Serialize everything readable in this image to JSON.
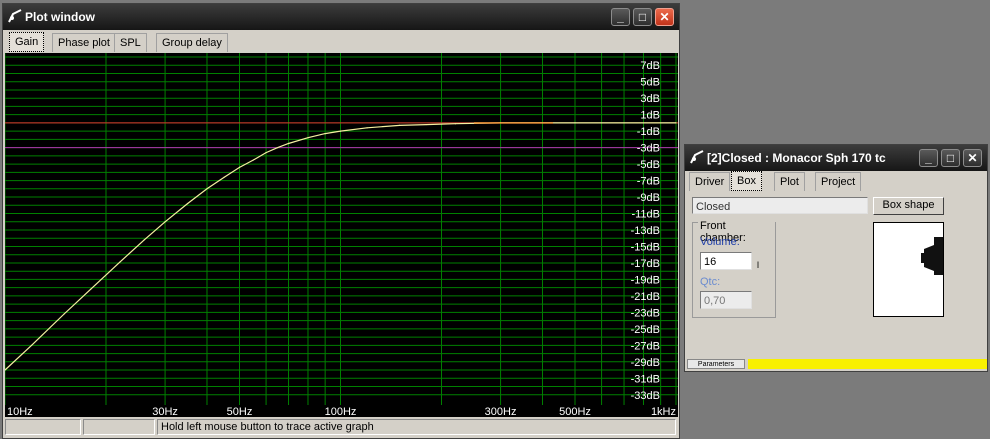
{
  "plot_window": {
    "title": "Plot window",
    "controls": {
      "minimize": "_",
      "maximize": "□",
      "close": "✕"
    },
    "tabs": [
      "Gain",
      "Phase plot",
      "SPL",
      "Group delay"
    ],
    "active_tab": "Gain",
    "status": {
      "cell1": "",
      "cell2": "",
      "hint": "Hold left mouse button to trace active graph"
    }
  },
  "chart_data": {
    "type": "line",
    "title": "",
    "x_scale": "log",
    "xlim": [
      10,
      1000
    ],
    "ylim": [
      -34,
      8
    ],
    "x_tick_labels": [
      {
        "x": 10,
        "label": "10Hz"
      },
      {
        "x": 30,
        "label": "30Hz"
      },
      {
        "x": 50,
        "label": "50Hz"
      },
      {
        "x": 100,
        "label": "100Hz"
      },
      {
        "x": 300,
        "label": "300Hz"
      },
      {
        "x": 500,
        "label": "500Hz"
      },
      {
        "x": 1000,
        "label": "1kHz"
      }
    ],
    "x_gridlines": [
      10,
      20,
      30,
      40,
      50,
      60,
      70,
      80,
      90,
      100,
      200,
      300,
      400,
      500,
      600,
      700,
      800,
      900,
      1000
    ],
    "y_tick_labels": [
      {
        "y": 7,
        "label": "7dB"
      },
      {
        "y": 5,
        "label": "5dB"
      },
      {
        "y": 3,
        "label": "3dB"
      },
      {
        "y": 1,
        "label": "1dB"
      },
      {
        "y": -1,
        "label": "-1dB"
      },
      {
        "y": -3,
        "label": "-3dB"
      },
      {
        "y": -5,
        "label": "-5dB"
      },
      {
        "y": -7,
        "label": "-7dB"
      },
      {
        "y": -9,
        "label": "-9dB"
      },
      {
        "y": -11,
        "label": "-11dB"
      },
      {
        "y": -13,
        "label": "-13dB"
      },
      {
        "y": -15,
        "label": "-15dB"
      },
      {
        "y": -17,
        "label": "-17dB"
      },
      {
        "y": -19,
        "label": "-19dB"
      },
      {
        "y": -21,
        "label": "-21dB"
      },
      {
        "y": -23,
        "label": "-23dB"
      },
      {
        "y": -25,
        "label": "-25dB"
      },
      {
        "y": -27,
        "label": "-27dB"
      },
      {
        "y": -29,
        "label": "-29dB"
      },
      {
        "y": -31,
        "label": "-31dB"
      },
      {
        "y": -33,
        "label": "-33dB"
      }
    ],
    "y_gridlines": [
      8,
      7,
      6,
      5,
      4,
      3,
      2,
      1,
      0,
      -1,
      -2,
      -3,
      -4,
      -5,
      -6,
      -7,
      -8,
      -9,
      -10,
      -11,
      -12,
      -13,
      -14,
      -15,
      -16,
      -17,
      -18,
      -19,
      -20,
      -21,
      -22,
      -23,
      -24,
      -25,
      -26,
      -27,
      -28,
      -29,
      -30,
      -31,
      -32,
      -33
    ],
    "reference_lines": [
      {
        "y": 0,
        "color": "#e03030"
      },
      {
        "y": -3,
        "color": "#b030b0"
      }
    ],
    "colors": {
      "background": "#000000",
      "grid": "#008000",
      "curve": "#f4f0a0",
      "curve_end": "#ff9a3c",
      "axis_text": "#ffffff"
    },
    "series": [
      {
        "color": "#f4f0a0",
        "points": [
          [
            10,
            -30.0
          ],
          [
            12,
            -27.0
          ],
          [
            15,
            -23.2
          ],
          [
            18,
            -20.2
          ],
          [
            22,
            -16.9
          ],
          [
            26,
            -14.2
          ],
          [
            30,
            -12.0
          ],
          [
            35,
            -9.8
          ],
          [
            40,
            -8.0
          ],
          [
            45,
            -6.6
          ],
          [
            50,
            -5.4
          ],
          [
            55,
            -4.5
          ],
          [
            60,
            -3.6
          ],
          [
            65,
            -3.0
          ],
          [
            70,
            -2.5
          ],
          [
            80,
            -1.8
          ],
          [
            90,
            -1.3
          ],
          [
            100,
            -1.0
          ],
          [
            120,
            -0.6
          ],
          [
            150,
            -0.3
          ],
          [
            180,
            -0.2
          ],
          [
            220,
            -0.1
          ],
          [
            300,
            0.0
          ],
          [
            500,
            0.0
          ],
          [
            1000,
            0.0
          ]
        ]
      }
    ]
  },
  "box_window": {
    "title": "[2]Closed : Monacor Sph 170 tc",
    "controls": {
      "minimize": "_",
      "maximize": "□",
      "close": "✕"
    },
    "tabs": [
      "Driver",
      "Box",
      "Plot",
      "Project"
    ],
    "active_tab": "Box",
    "box_type": "Closed",
    "box_shape_button": "Box shape",
    "front_chamber": {
      "label": "Front chamber:",
      "volume_label": "Volume:",
      "volume_value": "16",
      "unit": "l",
      "qtc_label": "Qtc:",
      "qtc_value": "0,70"
    },
    "bottom_tab": "Parameters",
    "colors": {
      "status_yellow": "#f8f000"
    }
  }
}
